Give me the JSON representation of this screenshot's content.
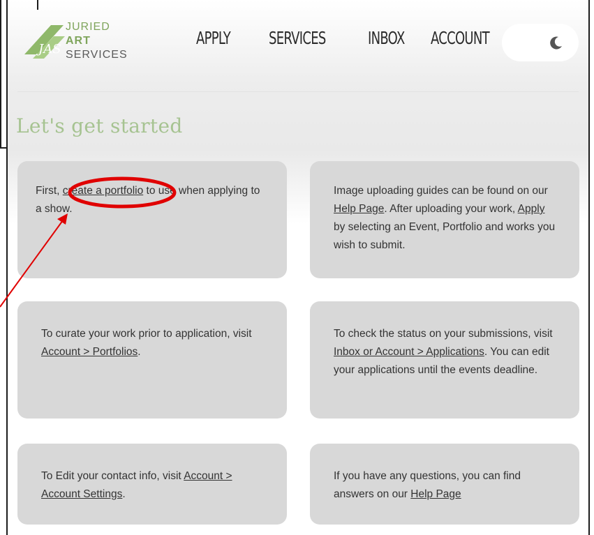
{
  "logo": {
    "line1": "JURIED",
    "line2": "ART",
    "line3": "SERVICES",
    "mark": "JAS"
  },
  "nav": [
    {
      "label": "APPLY"
    },
    {
      "label": "SERVICES"
    },
    {
      "label": "INBOX"
    },
    {
      "label": "ACCOUNT"
    }
  ],
  "theme_toggle": {
    "icon": "moon-icon"
  },
  "page_title": "Let's get started",
  "cards": [
    {
      "before": "First, ",
      "link": "create a portfolio",
      "after": " to use when applying to a show."
    },
    {
      "t1": "Image uploading guides can be found on our ",
      "link1": "Help Page",
      "t2": ". After uploading your work, ",
      "link2": "Apply",
      "t3": " by selecting an Event, Portfolio and works you wish to submit."
    },
    {
      "t1": "To curate your work prior to application, visit ",
      "link1": "Account > Portfolios",
      "t2": "."
    },
    {
      "t1": "To check the status on your submissions, visit ",
      "link1": "Inbox or Account > Applications",
      "t2": ". You can edit your applications until the events deadline."
    },
    {
      "t1": "To Edit your contact info, visit ",
      "link1": "Account > Account Settings",
      "t2": "."
    },
    {
      "t1": "If you have any questions, you can find answers on our ",
      "link1": "Help Page"
    }
  ],
  "colors": {
    "accent_green": "#7fa55c",
    "title_green": "#a6c391",
    "card_bg": "#d8d8d8",
    "annotation_red": "#e00000"
  }
}
